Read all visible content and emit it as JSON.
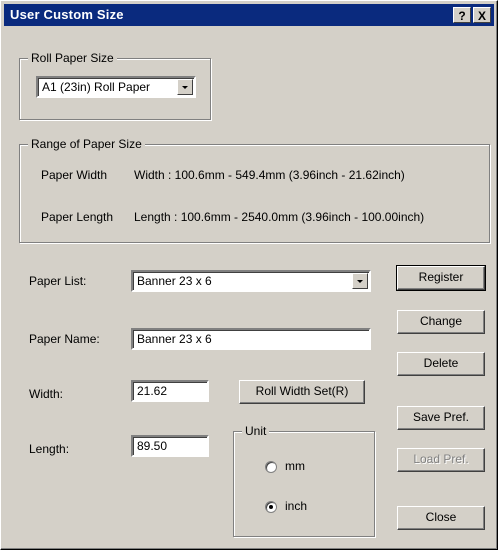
{
  "window": {
    "title": "User Custom Size",
    "help_button": "?",
    "close_button": "X"
  },
  "roll_paper": {
    "legend": "Roll Paper Size",
    "selected": "A1 (23in) Roll Paper"
  },
  "range": {
    "legend": "Range of Paper Size",
    "width_label": "Paper Width",
    "width_value": "Width   : 100.6mm -  549.4mm (3.96inch -  21.62inch)",
    "length_label": "Paper Length",
    "length_value": "Length : 100.6mm - 2540.0mm (3.96inch - 100.00inch)"
  },
  "form": {
    "paper_list_label": "Paper List:",
    "paper_list_value": "Banner 23 x 6",
    "paper_name_label": "Paper Name:",
    "paper_name_value": "Banner 23 x 6",
    "width_label": "Width:",
    "width_value": "21.62",
    "length_label": "Length:",
    "length_value": "89.50",
    "roll_width_button": "Roll Width Set(R)"
  },
  "unit": {
    "legend": "Unit",
    "options": [
      {
        "label": "mm",
        "selected": false
      },
      {
        "label": "inch",
        "selected": true
      }
    ]
  },
  "buttons": {
    "register": "Register",
    "change": "Change",
    "delete": "Delete",
    "save_pref": "Save Pref.",
    "load_pref": "Load Pref.",
    "close": "Close"
  }
}
